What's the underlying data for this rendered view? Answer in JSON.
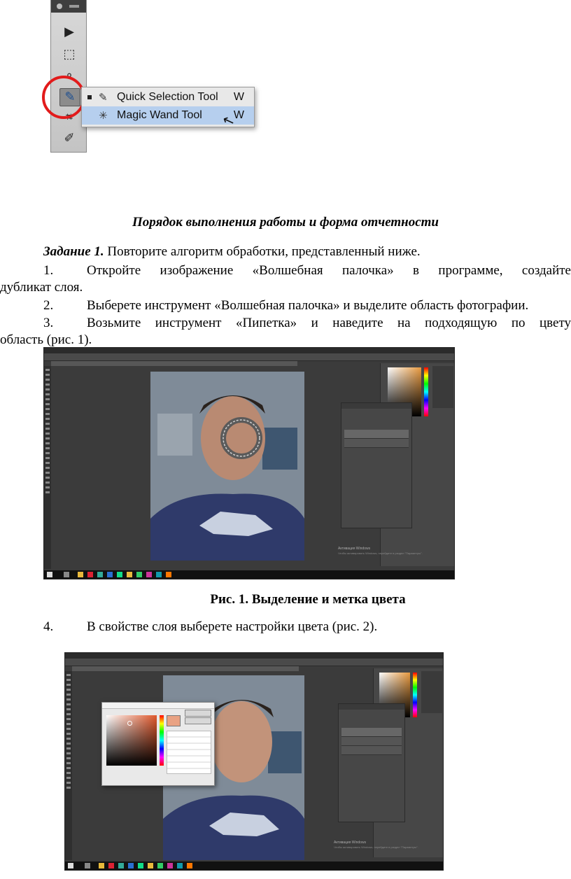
{
  "figure_tools": {
    "flyout_items": [
      {
        "label": "Quick Selection Tool",
        "shortcut": "W",
        "icon": "quick-selection-brush-icon"
      },
      {
        "label": "Magic Wand Tool",
        "shortcut": "W",
        "icon": "magic-wand-icon"
      }
    ],
    "highlight_color": "#b6cfee",
    "ring_color": "#e21b1b"
  },
  "section_heading": "Порядок выполнения работы и форма отчетности",
  "task": {
    "label": "Задание 1.",
    "text": " Повторите алгоритм обработки, представленный ниже."
  },
  "steps": [
    {
      "num": "1.",
      "line1": "Откройте изображение «Волшебная палочка» в программе, создайте",
      "line2": "дубликат слоя."
    },
    {
      "num": "2.",
      "line1": "Выберете инструмент «Волшебная палочка» и выделите область фотографии."
    },
    {
      "num": "3.",
      "line1": "Возьмите инструмент «Пипетка» и  наведите на подходящую по цвету",
      "line2": "область (рис. 1)."
    }
  ],
  "figure1_caption": "Рис. 1. Выделение и метка цвета",
  "step4": {
    "num": "4.",
    "text": "В свойстве слоя выберете настройки цвета (рис. 2)."
  },
  "screenshots": {
    "watermark_title": "Активация Windows",
    "watermark_text": "Чтобы активировать Windows, перейдите в раздел \"Параметры\"."
  }
}
